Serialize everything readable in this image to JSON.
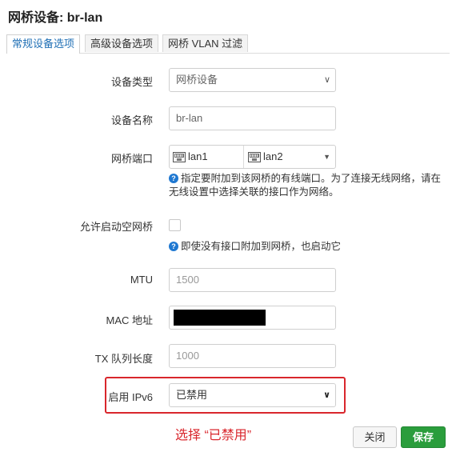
{
  "dialog": {
    "title": "网桥设备: br-lan",
    "tabs": [
      {
        "label": "常规设备选项",
        "active": true
      },
      {
        "label": "高级设备选项",
        "active": false
      },
      {
        "label": "网桥 VLAN 过滤",
        "active": false
      }
    ]
  },
  "form": {
    "device_type": {
      "label": "设备类型",
      "value": "网桥设备"
    },
    "device_name": {
      "label": "设备名称",
      "value": "br-lan"
    },
    "bridge_ports": {
      "label": "网桥端口",
      "ports": [
        "lan1",
        "lan2"
      ],
      "help": "指定要附加到该网桥的有线端口。为了连接无线网络，请在无线设置中选择关联的接口作为网络。"
    },
    "allow_empty": {
      "label": "允许启动空网桥",
      "checked": false,
      "help": "即使没有接口附加到网桥，也启动它"
    },
    "mtu": {
      "label": "MTU",
      "placeholder": "1500"
    },
    "mac": {
      "label": "MAC 地址",
      "value_redacted": true
    },
    "tx_queue": {
      "label": "TX 队列长度",
      "placeholder": "1000"
    },
    "ipv6": {
      "label": "启用 IPv6",
      "value": "已禁用"
    }
  },
  "annotation": {
    "text": "选择 “已禁用”",
    "color": "#d9262c"
  },
  "buttons": {
    "close": "关闭",
    "save": "保存"
  },
  "colors": {
    "save_bg": "#2a9d3c",
    "active_tab": "#1f6fb5",
    "highlight": "#d9262c"
  }
}
